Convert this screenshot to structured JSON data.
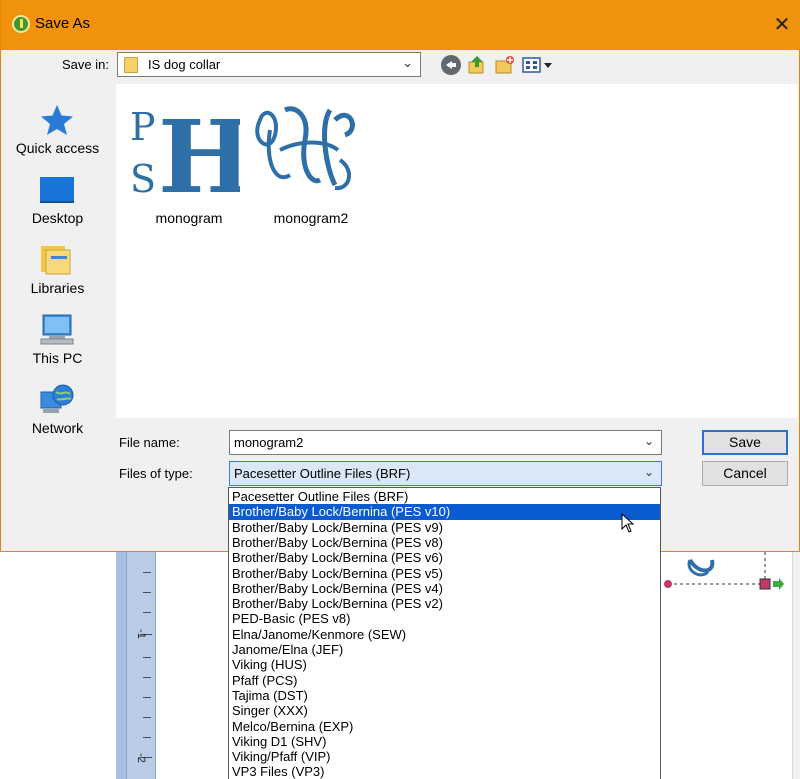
{
  "window": {
    "title": "Save As"
  },
  "toolbar": {
    "save_in_label": "Save in:",
    "save_in_value": "IS dog collar"
  },
  "places": [
    {
      "label": "Quick access",
      "icon": "star-icon"
    },
    {
      "label": "Desktop",
      "icon": "desktop-icon"
    },
    {
      "label": "Libraries",
      "icon": "libraries-icon"
    },
    {
      "label": "This PC",
      "icon": "computer-icon"
    },
    {
      "label": "Network",
      "icon": "network-icon"
    }
  ],
  "files": [
    {
      "name": "monogram",
      "thumb_text": "PHS"
    },
    {
      "name": "monogram2",
      "thumb_text": "PHS"
    }
  ],
  "form": {
    "file_name_label": "File name:",
    "file_name_value": "monogram2",
    "file_type_label": "Files of type:",
    "file_type_value": "Pacesetter Outline Files (BRF)"
  },
  "buttons": {
    "save": "Save",
    "cancel": "Cancel"
  },
  "file_types": [
    "Pacesetter Outline Files (BRF)",
    "Brother/Baby Lock/Bernina (PES v10)",
    "Brother/Baby Lock/Bernina (PES v9)",
    "Brother/Baby Lock/Bernina (PES v8)",
    "Brother/Baby Lock/Bernina (PES v6)",
    "Brother/Baby Lock/Bernina (PES v5)",
    "Brother/Baby Lock/Bernina (PES v4)",
    "Brother/Baby Lock/Bernina (PES v2)",
    "PED-Basic (PES v8)",
    "Elna/Janome/Kenmore (SEW)",
    "Janome/Elna (JEF)",
    "Viking (HUS)",
    "Pfaff (PCS)",
    "Tajima (DST)",
    "Singer (XXX)",
    "Melco/Bernina (EXP)",
    "Viking D1 (SHV)",
    "Viking/Pfaff (VIP)",
    "VP3 Files (VP3)"
  ],
  "selected_file_type_index": 1,
  "background_ruler": {
    "labels": [
      "-1",
      "-2"
    ]
  },
  "colors": {
    "title_bar": "#f0920b",
    "selection": "#0a5bd0",
    "thread_blue": "#2f6fa8"
  }
}
